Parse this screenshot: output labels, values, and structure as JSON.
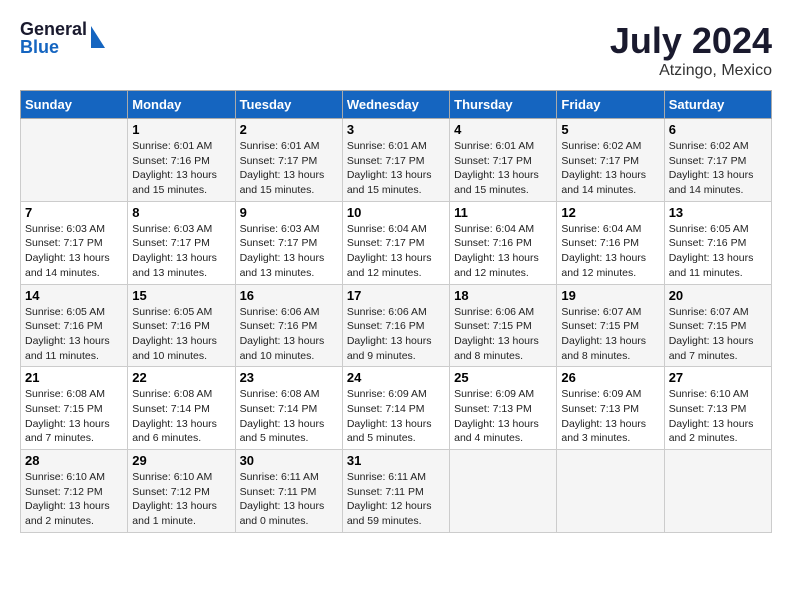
{
  "header": {
    "logo_general": "General",
    "logo_blue": "Blue",
    "title": "July 2024",
    "subtitle": "Atzingo, Mexico"
  },
  "days_of_week": [
    "Sunday",
    "Monday",
    "Tuesday",
    "Wednesday",
    "Thursday",
    "Friday",
    "Saturday"
  ],
  "weeks": [
    [
      {
        "day": "",
        "info": ""
      },
      {
        "day": "1",
        "info": "Sunrise: 6:01 AM\nSunset: 7:16 PM\nDaylight: 13 hours\nand 15 minutes."
      },
      {
        "day": "2",
        "info": "Sunrise: 6:01 AM\nSunset: 7:17 PM\nDaylight: 13 hours\nand 15 minutes."
      },
      {
        "day": "3",
        "info": "Sunrise: 6:01 AM\nSunset: 7:17 PM\nDaylight: 13 hours\nand 15 minutes."
      },
      {
        "day": "4",
        "info": "Sunrise: 6:01 AM\nSunset: 7:17 PM\nDaylight: 13 hours\nand 15 minutes."
      },
      {
        "day": "5",
        "info": "Sunrise: 6:02 AM\nSunset: 7:17 PM\nDaylight: 13 hours\nand 14 minutes."
      },
      {
        "day": "6",
        "info": "Sunrise: 6:02 AM\nSunset: 7:17 PM\nDaylight: 13 hours\nand 14 minutes."
      }
    ],
    [
      {
        "day": "7",
        "info": "Sunrise: 6:03 AM\nSunset: 7:17 PM\nDaylight: 13 hours\nand 14 minutes."
      },
      {
        "day": "8",
        "info": "Sunrise: 6:03 AM\nSunset: 7:17 PM\nDaylight: 13 hours\nand 13 minutes."
      },
      {
        "day": "9",
        "info": "Sunrise: 6:03 AM\nSunset: 7:17 PM\nDaylight: 13 hours\nand 13 minutes."
      },
      {
        "day": "10",
        "info": "Sunrise: 6:04 AM\nSunset: 7:17 PM\nDaylight: 13 hours\nand 12 minutes."
      },
      {
        "day": "11",
        "info": "Sunrise: 6:04 AM\nSunset: 7:16 PM\nDaylight: 13 hours\nand 12 minutes."
      },
      {
        "day": "12",
        "info": "Sunrise: 6:04 AM\nSunset: 7:16 PM\nDaylight: 13 hours\nand 12 minutes."
      },
      {
        "day": "13",
        "info": "Sunrise: 6:05 AM\nSunset: 7:16 PM\nDaylight: 13 hours\nand 11 minutes."
      }
    ],
    [
      {
        "day": "14",
        "info": "Sunrise: 6:05 AM\nSunset: 7:16 PM\nDaylight: 13 hours\nand 11 minutes."
      },
      {
        "day": "15",
        "info": "Sunrise: 6:05 AM\nSunset: 7:16 PM\nDaylight: 13 hours\nand 10 minutes."
      },
      {
        "day": "16",
        "info": "Sunrise: 6:06 AM\nSunset: 7:16 PM\nDaylight: 13 hours\nand 10 minutes."
      },
      {
        "day": "17",
        "info": "Sunrise: 6:06 AM\nSunset: 7:16 PM\nDaylight: 13 hours\nand 9 minutes."
      },
      {
        "day": "18",
        "info": "Sunrise: 6:06 AM\nSunset: 7:15 PM\nDaylight: 13 hours\nand 8 minutes."
      },
      {
        "day": "19",
        "info": "Sunrise: 6:07 AM\nSunset: 7:15 PM\nDaylight: 13 hours\nand 8 minutes."
      },
      {
        "day": "20",
        "info": "Sunrise: 6:07 AM\nSunset: 7:15 PM\nDaylight: 13 hours\nand 7 minutes."
      }
    ],
    [
      {
        "day": "21",
        "info": "Sunrise: 6:08 AM\nSunset: 7:15 PM\nDaylight: 13 hours\nand 7 minutes."
      },
      {
        "day": "22",
        "info": "Sunrise: 6:08 AM\nSunset: 7:14 PM\nDaylight: 13 hours\nand 6 minutes."
      },
      {
        "day": "23",
        "info": "Sunrise: 6:08 AM\nSunset: 7:14 PM\nDaylight: 13 hours\nand 5 minutes."
      },
      {
        "day": "24",
        "info": "Sunrise: 6:09 AM\nSunset: 7:14 PM\nDaylight: 13 hours\nand 5 minutes."
      },
      {
        "day": "25",
        "info": "Sunrise: 6:09 AM\nSunset: 7:13 PM\nDaylight: 13 hours\nand 4 minutes."
      },
      {
        "day": "26",
        "info": "Sunrise: 6:09 AM\nSunset: 7:13 PM\nDaylight: 13 hours\nand 3 minutes."
      },
      {
        "day": "27",
        "info": "Sunrise: 6:10 AM\nSunset: 7:13 PM\nDaylight: 13 hours\nand 2 minutes."
      }
    ],
    [
      {
        "day": "28",
        "info": "Sunrise: 6:10 AM\nSunset: 7:12 PM\nDaylight: 13 hours\nand 2 minutes."
      },
      {
        "day": "29",
        "info": "Sunrise: 6:10 AM\nSunset: 7:12 PM\nDaylight: 13 hours\nand 1 minute."
      },
      {
        "day": "30",
        "info": "Sunrise: 6:11 AM\nSunset: 7:11 PM\nDaylight: 13 hours\nand 0 minutes."
      },
      {
        "day": "31",
        "info": "Sunrise: 6:11 AM\nSunset: 7:11 PM\nDaylight: 12 hours\nand 59 minutes."
      },
      {
        "day": "",
        "info": ""
      },
      {
        "day": "",
        "info": ""
      },
      {
        "day": "",
        "info": ""
      }
    ]
  ]
}
